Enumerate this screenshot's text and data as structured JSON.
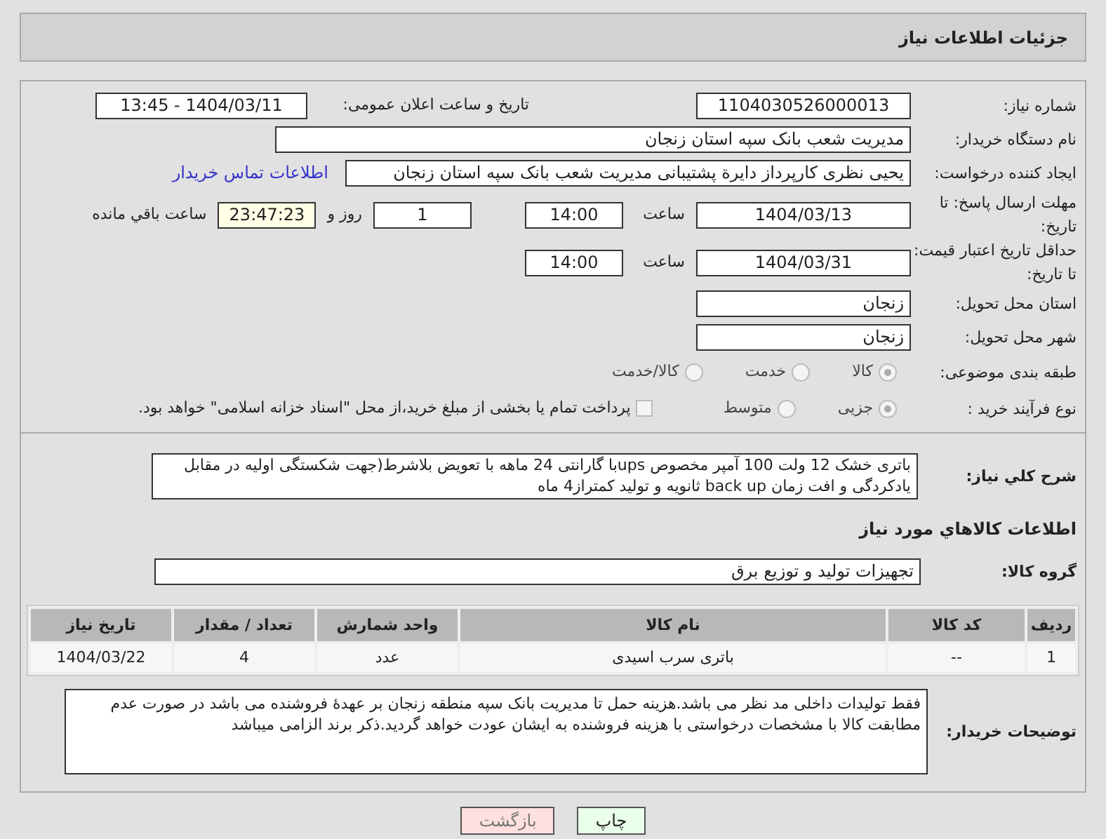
{
  "header": {
    "title": "جزئیات اطلاعات نیاز"
  },
  "need_number": {
    "label": "شماره نیاز:",
    "value": "1104030526000013"
  },
  "announce": {
    "label": "تاریخ و ساعت اعلان عمومی:",
    "value": "1404/03/11 - 13:45"
  },
  "buyer_org": {
    "label": "نام دستگاه خریدار:",
    "value": "مدیریت شعب بانک سپه استان زنجان"
  },
  "creator": {
    "label": "ایجاد کننده درخواست:",
    "value": "یحیی نظری کارپرداز دایرة پشتیبانی  مدیریت شعب بانک سپه استان زنجان",
    "link": "اطلاعات تماس خریدار"
  },
  "deadline": {
    "label": "مهلت ارسال پاسخ: تا تاریخ:",
    "date": "1404/03/13",
    "time_label": "ساعت",
    "time": "14:00",
    "days": "1",
    "days_label": "روز و",
    "remaining": "23:47:23",
    "remaining_label": "ساعت باقي مانده"
  },
  "validity": {
    "label": "حداقل تاریخ اعتبار قیمت: تا تاریخ:",
    "date": "1404/03/31",
    "time_label": "ساعت",
    "time": "14:00"
  },
  "province": {
    "label": "استان محل تحویل:",
    "value": "زنجان"
  },
  "city": {
    "label": "شهر محل تحویل:",
    "value": "زنجان"
  },
  "category": {
    "label": "طبقه بندی موضوعی:",
    "options": [
      {
        "label": "کالا",
        "selected": true
      },
      {
        "label": "خدمت",
        "selected": false
      },
      {
        "label": "کالا/خدمت",
        "selected": false
      }
    ]
  },
  "process": {
    "label": "نوع فرآیند خرید :",
    "options": [
      {
        "label": "جزیی",
        "selected": true
      },
      {
        "label": "متوسط",
        "selected": false
      }
    ],
    "treasury": {
      "label": "پرداخت تمام یا بخشی از مبلغ خرید،از محل \"اسناد خزانه اسلامی\" خواهد بود.",
      "checked": false
    }
  },
  "description": {
    "label": "شرح کلي نیاز:",
    "value": "باتری خشک 12 ولت 100 آمپر مخصوص upsبا گارانتی 24 ماهه با تعویض بلاشرط(جهت شکستگی اولیه در مقابل یادکردگی و افت زمان back up ثانویه و تولید کمتراز4 ماه"
  },
  "goods_heading": "اطلاعات كالاهاي مورد نیاز",
  "goods_group": {
    "label": "گروه کالا:",
    "value": "تجهیزات تولید و توزیع برق"
  },
  "table": {
    "columns": [
      "ردیف",
      "کد کالا",
      "نام کالا",
      "واحد شمارش",
      "تعداد / مقدار",
      "تاریخ نیاز"
    ],
    "rows": [
      [
        "1",
        "--",
        "باتری سرب اسیدی",
        "عدد",
        "4",
        "1404/03/22"
      ]
    ]
  },
  "buyer_notes": {
    "label": "توضیحات خریدار:",
    "value": "فقط تولیدات داخلی مد نظر می باشد.هزینه حمل تا مدیریت بانک سپه منطقه زنجان بر عهدهٔ فروشنده می باشد در صورت عدم مطابقت کالا با مشخصات درخواستی با هزینه فروشنده به ایشان عودت خواهد گردید.ذکر برند الزامی میباشد"
  },
  "buttons": [
    {
      "label": "چاپ",
      "kind": "print"
    },
    {
      "label": "بازگشت",
      "kind": "back"
    }
  ]
}
